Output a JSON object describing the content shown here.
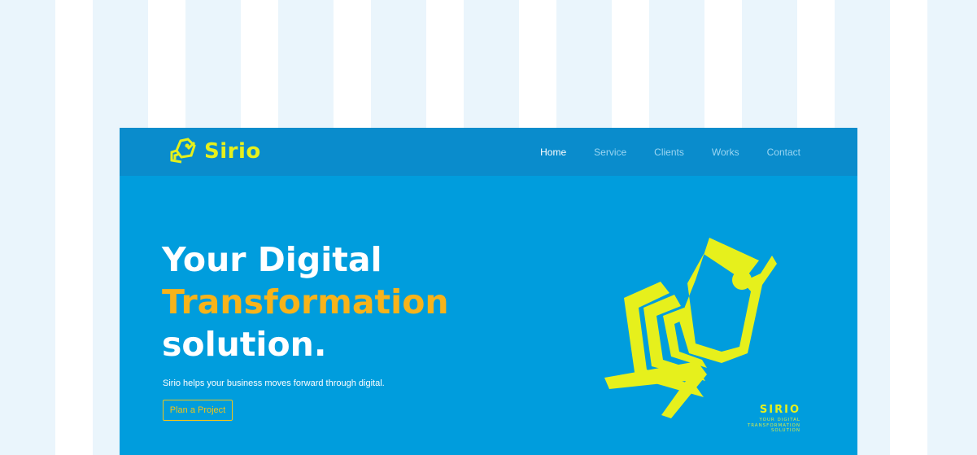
{
  "colors": {
    "page_stripe": "#eaf5fc",
    "hero_bg": "#009ddd",
    "navbar_bg": "#0a8ccc",
    "brand_yellow": "#e6f01c",
    "accent_orange": "#f7b31a"
  },
  "header": {
    "brand": "Sirio",
    "logo_icon": "sirio-bird-logo",
    "nav": [
      {
        "label": "Home",
        "active": true
      },
      {
        "label": "Service",
        "active": false
      },
      {
        "label": "Clients",
        "active": false
      },
      {
        "label": "Works",
        "active": false
      },
      {
        "label": "Contact",
        "active": false
      }
    ]
  },
  "hero": {
    "title_line1": "Your Digital",
    "title_line2": "Transformation",
    "title_line3": "solution.",
    "subtitle": "Sirio helps your business moves forward through digital.",
    "cta_label": "Plan a Project",
    "logo_name": "SIRIO",
    "logo_tagline": "YOUR DIGITAL\nTRANSFORMATION\nSOLUTION"
  }
}
